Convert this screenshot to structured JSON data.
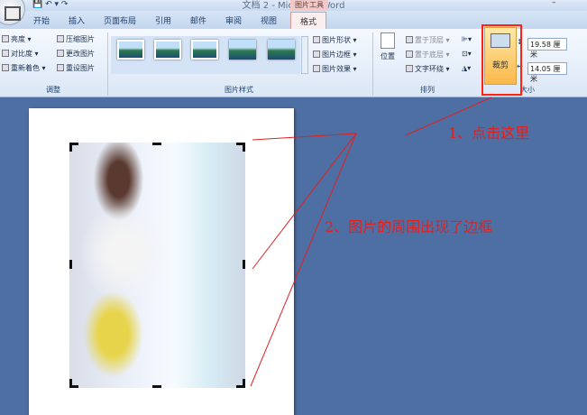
{
  "window": {
    "title": "文档 2 - Microsoft Word",
    "tool_tab": "图片工具",
    "minimize": "–"
  },
  "tabs": [
    "开始",
    "插入",
    "页面布局",
    "引用",
    "邮件",
    "审阅",
    "视图",
    "格式"
  ],
  "adjust": {
    "items": [
      "亮度 ▾",
      "对比度 ▾",
      "重新着色 ▾",
      "压缩图片",
      "更改图片",
      "重设图片"
    ],
    "label": "调整"
  },
  "styles": {
    "label": "图片样式",
    "items": [
      "图片形状 ▾",
      "图片边框 ▾",
      "图片效果 ▾"
    ]
  },
  "arrange": {
    "label": "排列",
    "position": "位置",
    "items": [
      "置于顶层 ▾",
      "置于底层 ▾",
      "文字环绕 ▾"
    ]
  },
  "size": {
    "label": "大小",
    "crop": "裁剪",
    "height": "19.58 厘米",
    "width": "14.05 厘米"
  },
  "annotations": {
    "note1": "1、点击这里",
    "note2": "2、图片的周围出现了边框"
  },
  "colors": {
    "annotation": "#e12020"
  }
}
